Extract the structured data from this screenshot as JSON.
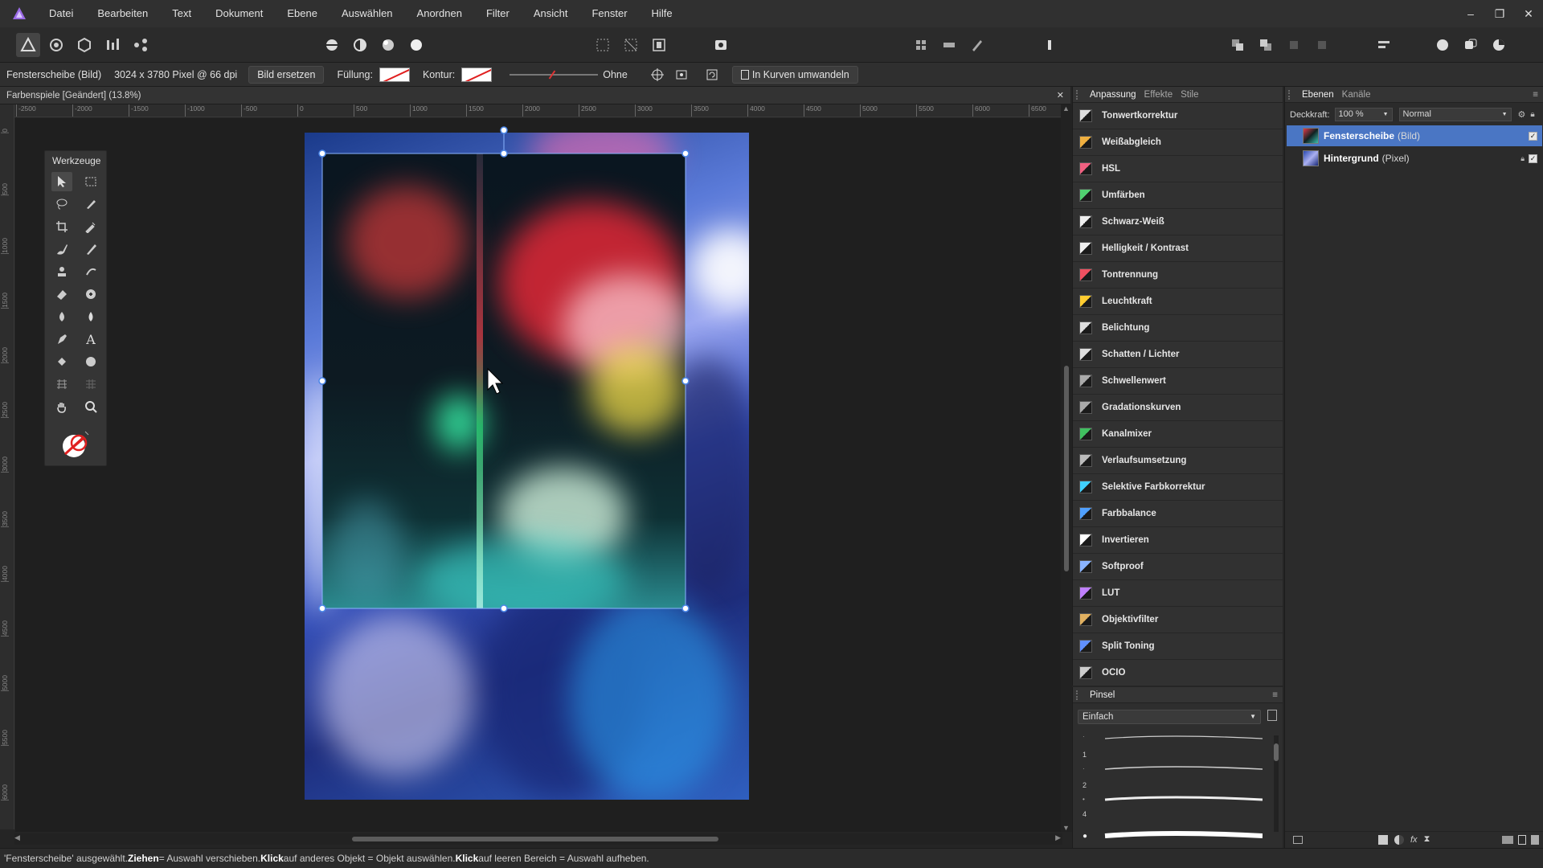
{
  "menu": [
    "Datei",
    "Bearbeiten",
    "Text",
    "Dokument",
    "Ebene",
    "Auswählen",
    "Anordnen",
    "Filter",
    "Ansicht",
    "Fenster",
    "Hilfe"
  ],
  "context": {
    "object": "Fensterscheibe (Bild)",
    "size": "3024 x 3780 Pixel @ 66 dpi",
    "replace_button": "Bild ersetzen",
    "fill_label": "Füllung:",
    "stroke_label": "Kontur:",
    "stroke_value": "Ohne",
    "convert_button": "In Kurven umwandeln"
  },
  "document": {
    "tab_title": "Farbenspiele [Geändert] (13.8%)",
    "close": "✕"
  },
  "ruler_h": [
    "-2500",
    "-2000",
    "-1500",
    "-1000",
    "-500",
    "0",
    "500",
    "1000",
    "1500",
    "2000",
    "2500",
    "3000",
    "3500",
    "4000",
    "4500",
    "5000",
    "5500",
    "6000",
    "6500"
  ],
  "ruler_v": [
    "0",
    "500",
    "1000",
    "1500",
    "2000",
    "2500",
    "3000",
    "3500",
    "4000",
    "4500",
    "5000",
    "5500",
    "6000",
    "6500"
  ],
  "tools": {
    "title": "Werkzeuge"
  },
  "adjustments": {
    "tabs": [
      "Anpassung",
      "Effekte",
      "Stile"
    ],
    "items": [
      "Tonwertkorrektur",
      "Weißabgleich",
      "HSL",
      "Umfärben",
      "Schwarz-Weiß",
      "Helligkeit / Kontrast",
      "Tontrennung",
      "Leuchtkraft",
      "Belichtung",
      "Schatten / Lichter",
      "Schwellenwert",
      "Gradationskurven",
      "Kanalmixer",
      "Verlaufsumsetzung",
      "Selektive Farbkorrektur",
      "Farbbalance",
      "Invertieren",
      "Softproof",
      "LUT",
      "Objektivfilter",
      "Split Toning",
      "OCIO"
    ]
  },
  "brushes": {
    "tab": "Pinsel",
    "category": "Einfach",
    "sizes": [
      "1",
      "2",
      "4"
    ]
  },
  "layers": {
    "tabs": [
      "Ebenen",
      "Kanäle"
    ],
    "opacity_label": "Deckkraft:",
    "opacity_value": "100 %",
    "blend_mode": "Normal",
    "items": [
      {
        "name": "Fensterscheibe",
        "type": "(Bild)"
      },
      {
        "name": "Hintergrund",
        "type": "(Pixel)"
      }
    ]
  },
  "status": {
    "p1": "'Fensterscheibe' ausgewählt. ",
    "b1": "Ziehen",
    "p2": " = Auswahl verschieben. ",
    "b2": "Klick",
    "p3": " auf anderes Objekt = Objekt auswählen. ",
    "b3": "Klick",
    "p4": " auf leeren Bereich = Auswahl aufheben."
  },
  "colors": {
    "accent": "#4a76c4",
    "selection_handle": "#6aa0ff",
    "brand": "#7b4fc9"
  }
}
